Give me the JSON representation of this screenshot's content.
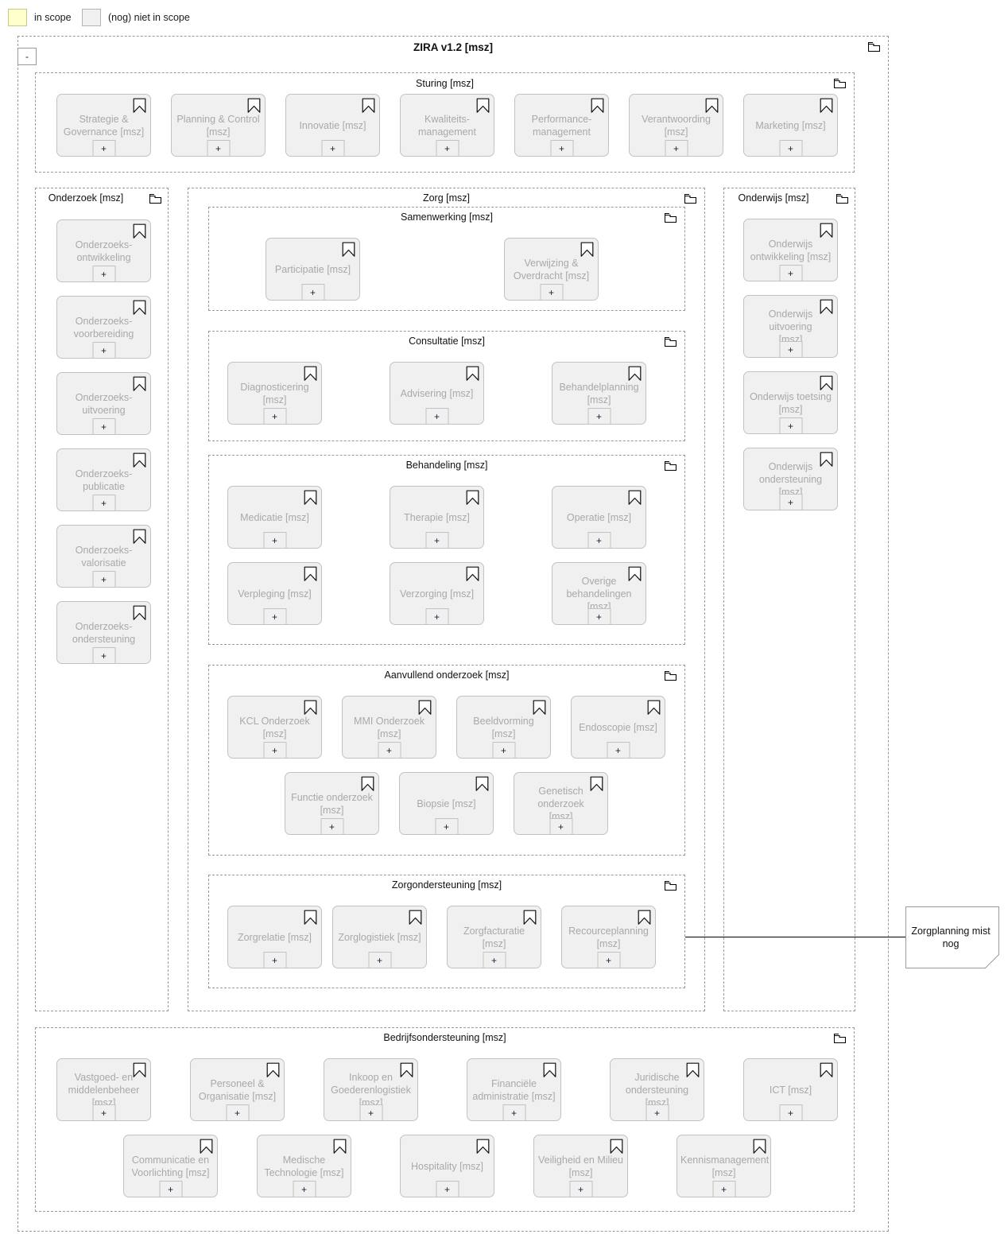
{
  "legend": {
    "in_scope": {
      "label": "in scope",
      "color": "#ffffcc"
    },
    "not_in_scope": {
      "label": "(nog) niet in scope",
      "color": "#f0f0f0"
    }
  },
  "diagram": {
    "title": "ZIRA v1.2 [msz]",
    "collapse_label": "-",
    "plus_label": "+",
    "folder_icon": "folder-icon",
    "capability_icon": "capability-icon"
  },
  "groups": {
    "sturing": {
      "title": "Sturing [msz]",
      "items": [
        {
          "label": "Strategie &\nGovernance [msz]"
        },
        {
          "label": "Planning & Control\n[msz]"
        },
        {
          "label": "Innovatie [msz]"
        },
        {
          "label": "Kwaliteits-\nmanagement"
        },
        {
          "label": "Performance-\nmanagement"
        },
        {
          "label": "Verantwoording\n[msz]"
        },
        {
          "label": "Marketing [msz]"
        }
      ]
    },
    "onderzoek": {
      "title": "Onderzoek [msz]",
      "items": [
        {
          "label": "Onderzoeks-\nontwikkeling"
        },
        {
          "label": "Onderzoeks-\nvoorbereiding"
        },
        {
          "label": "Onderzoeks-\nuitvoering"
        },
        {
          "label": "Onderzoeks-\npublicatie"
        },
        {
          "label": "Onderzoeks-\nvalorisatie"
        },
        {
          "label": "Onderzoeks-\nondersteuning"
        }
      ]
    },
    "zorg": {
      "title": "Zorg [msz]",
      "subgroups": {
        "samenwerking": {
          "title": "Samenwerking [msz]",
          "items": [
            {
              "label": "Participatie [msz]"
            },
            {
              "label": "Verwijzing &\nOverdracht [msz]"
            }
          ]
        },
        "consultatie": {
          "title": "Consultatie [msz]",
          "items": [
            {
              "label": "Diagnosticering\n[msz]"
            },
            {
              "label": "Advisering [msz]"
            },
            {
              "label": "Behandelplanning\n[msz]"
            }
          ]
        },
        "behandeling": {
          "title": "Behandeling [msz]",
          "items": [
            {
              "label": "Medicatie [msz]"
            },
            {
              "label": "Therapie [msz]"
            },
            {
              "label": "Operatie [msz]"
            },
            {
              "label": "Verpleging [msz]"
            },
            {
              "label": "Verzorging [msz]"
            },
            {
              "label": "Overige\nbehandelingen [msz]"
            }
          ]
        },
        "aanvullend_onderzoek": {
          "title": "Aanvullend onderzoek [msz]",
          "items": [
            {
              "label": "KCL Onderzoek [msz]"
            },
            {
              "label": "MMI Onderzoek\n[msz]"
            },
            {
              "label": "Beeldvorming [msz]"
            },
            {
              "label": "Endoscopie [msz]"
            },
            {
              "label": "Functie onderzoek\n[msz]"
            },
            {
              "label": "Biopsie [msz]"
            },
            {
              "label": "Genetisch onderzoek\n[msz]"
            }
          ]
        },
        "zorgondersteuning": {
          "title": "Zorgondersteuning [msz]",
          "items": [
            {
              "label": "Zorgrelatie [msz]"
            },
            {
              "label": "Zorglogistiek [msz]"
            },
            {
              "label": "Zorgfacturatie [msz]"
            },
            {
              "label": "Recourceplanning\n[msz]"
            }
          ]
        }
      }
    },
    "onderwijs": {
      "title": "Onderwijs [msz]",
      "items": [
        {
          "label": "Onderwijs\nontwikkeling [msz]"
        },
        {
          "label": "Onderwijs uitvoering\n[msz]"
        },
        {
          "label": "Onderwijs toetsing\n[msz]"
        },
        {
          "label": "Onderwijs\nondersteuning [msz]"
        }
      ]
    },
    "bedrijfsondersteuning": {
      "title": "Bedrijfsondersteuning [msz]",
      "items": [
        {
          "label": "Vastgoed- en\nmiddelenbeheer\n[msz]"
        },
        {
          "label": "Personeel &\nOrganisatie [msz]"
        },
        {
          "label": "Inkoop en\nGoederenlogistiek\n[msz]"
        },
        {
          "label": "Financiële\nadministratie [msz]"
        },
        {
          "label": "Juridische\nondersteuning [msz]"
        },
        {
          "label": "ICT [msz]"
        },
        {
          "label": "Communicatie en\nVoorlichting [msz]"
        },
        {
          "label": "Medische\nTechnologie [msz]"
        },
        {
          "label": "Hospitality [msz]"
        },
        {
          "label": "Veiligheid en Milieu\n[msz]"
        },
        {
          "label": "Kennismanagement\n[msz]"
        }
      ]
    }
  },
  "note": {
    "text": "Zorgplanning mist\nnog"
  }
}
